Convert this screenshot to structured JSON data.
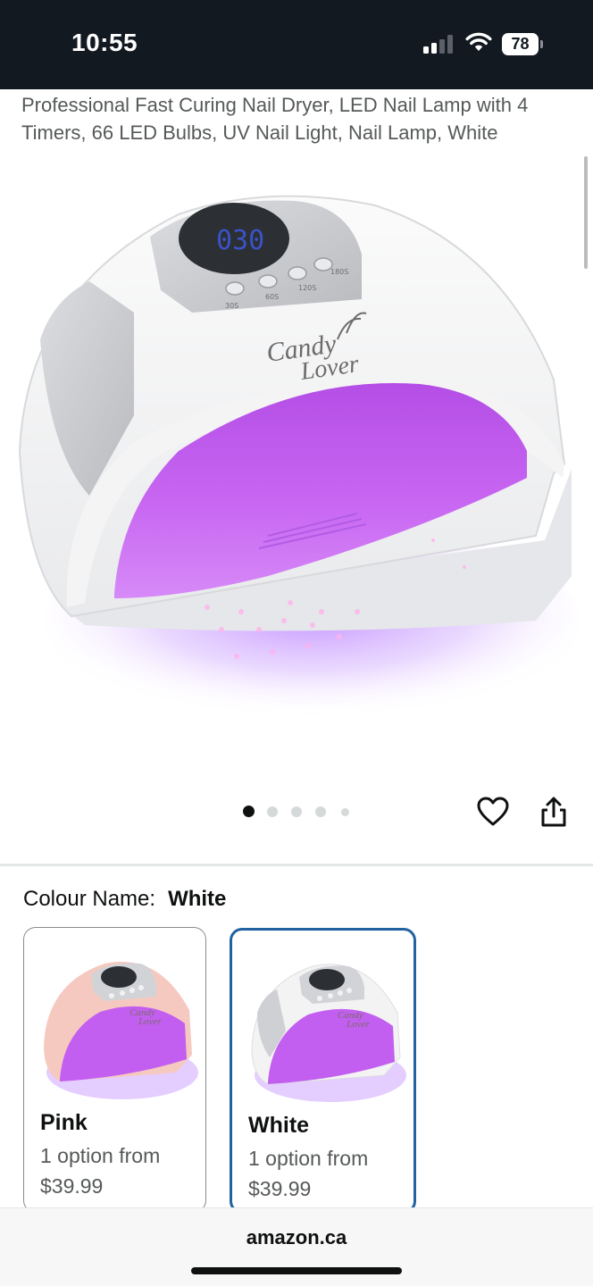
{
  "status_bar": {
    "time": "10:55",
    "battery": "78"
  },
  "product": {
    "title": "Professional Fast Curing Nail Dryer, LED Nail Lamp with 4 Timers, 66 LED Bulbs, UV Nail Light, Nail Lamp, White",
    "image_brand_line1": "Candy",
    "image_brand_line2": "Lover",
    "image_display": "030",
    "image_timers": [
      "30S",
      "60S",
      "120S",
      "180S"
    ],
    "image_count": 5,
    "active_image_index": 0
  },
  "variations": {
    "label": "Colour Name:",
    "selected": "White",
    "options": [
      {
        "name": "Pink",
        "availability": "1 option from",
        "price": "$39.99",
        "selected": false
      },
      {
        "name": "White",
        "availability": "1 option from",
        "price": "$39.99",
        "selected": true
      }
    ]
  },
  "footer": {
    "domain": "amazon.ca"
  },
  "colors": {
    "status_bar_bg": "#131921",
    "selected_border": "#2162a1",
    "lamp_glow": "#c65cf0",
    "pink_body": "#f6c9c0"
  },
  "icons": [
    "signal-icon",
    "wifi-icon",
    "battery-icon",
    "heart-icon",
    "share-icon"
  ]
}
